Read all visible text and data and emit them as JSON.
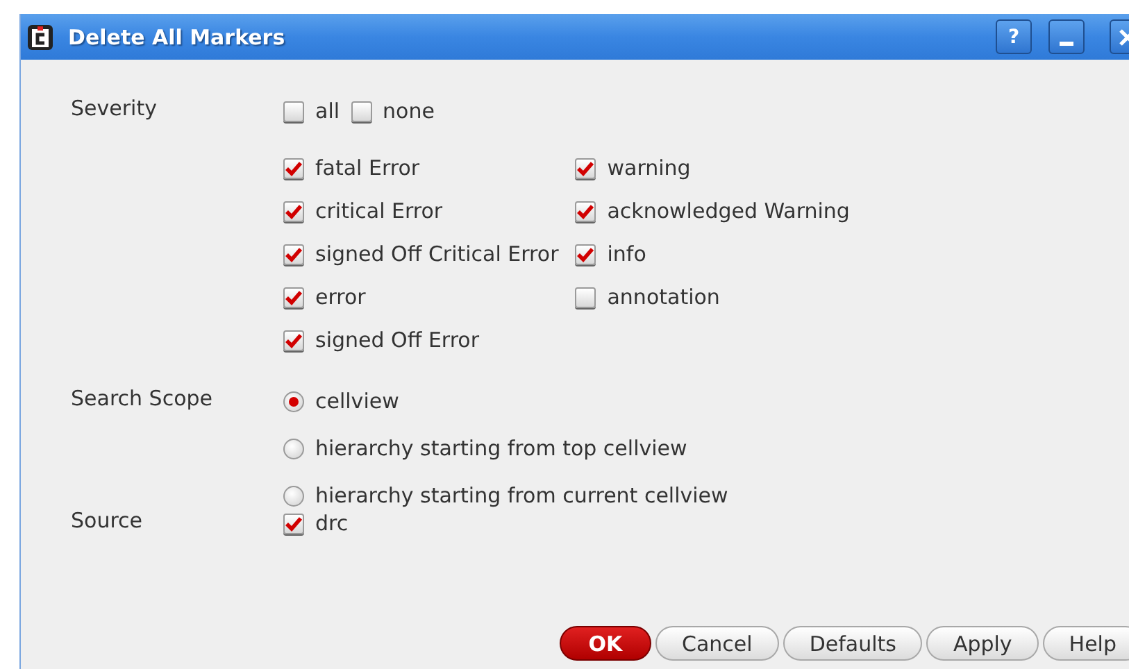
{
  "window": {
    "title": "Delete All Markers",
    "controls": [
      {
        "kind": "help",
        "label": "?"
      },
      {
        "kind": "minimize"
      },
      {
        "kind": "close"
      }
    ]
  },
  "severity": {
    "label": "Severity",
    "quick": [
      {
        "label": "all",
        "checked": false
      },
      {
        "label": "none",
        "checked": false
      }
    ],
    "columns": [
      [
        {
          "label": "fatal Error",
          "checked": true
        },
        {
          "label": "critical Error",
          "checked": true
        },
        {
          "label": "signed Off Critical Error",
          "checked": true
        },
        {
          "label": "error",
          "checked": true
        },
        {
          "label": "signed Off Error",
          "checked": true
        }
      ],
      [
        {
          "label": "warning",
          "checked": true
        },
        {
          "label": "acknowledged Warning",
          "checked": true
        },
        {
          "label": "info",
          "checked": true
        },
        {
          "label": "annotation",
          "checked": false
        }
      ]
    ]
  },
  "search_scope": {
    "label": "Search Scope",
    "options": [
      {
        "label": "cellview",
        "selected": true
      },
      {
        "label": "hierarchy starting from top cellview",
        "selected": false
      },
      {
        "label": "hierarchy starting from current cellview",
        "selected": false
      }
    ]
  },
  "source": {
    "label": "Source",
    "options": [
      {
        "label": "drc",
        "checked": true
      }
    ]
  },
  "buttons": [
    {
      "label": "OK",
      "kind": "primary"
    },
    {
      "label": "Cancel",
      "kind": "normal"
    },
    {
      "label": "Defaults",
      "kind": "normal"
    },
    {
      "label": "Apply",
      "kind": "normal"
    },
    {
      "label": "Help",
      "kind": "normal"
    }
  ]
}
